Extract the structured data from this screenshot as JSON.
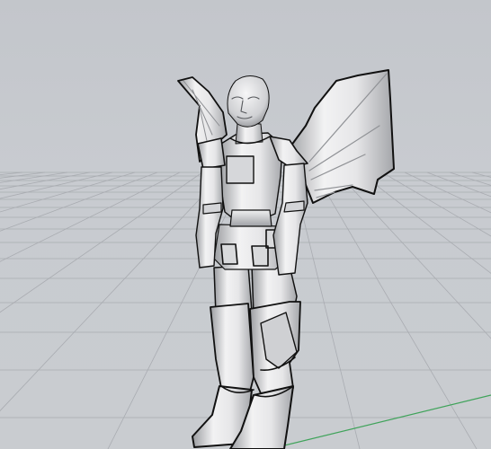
{
  "viewport": {
    "view_type": "perspective",
    "background_color": "#c8cbd0",
    "grid_color": "#a9acb1",
    "axis_colors": {
      "x": "#d44b4b",
      "y": "#3fa35a"
    }
  },
  "scene": {
    "object": "winged-humanoid-model",
    "render_style": "shaded-with-silhouette-edges",
    "surface_color": "#e4e4e6",
    "edge_color": "#111111"
  }
}
